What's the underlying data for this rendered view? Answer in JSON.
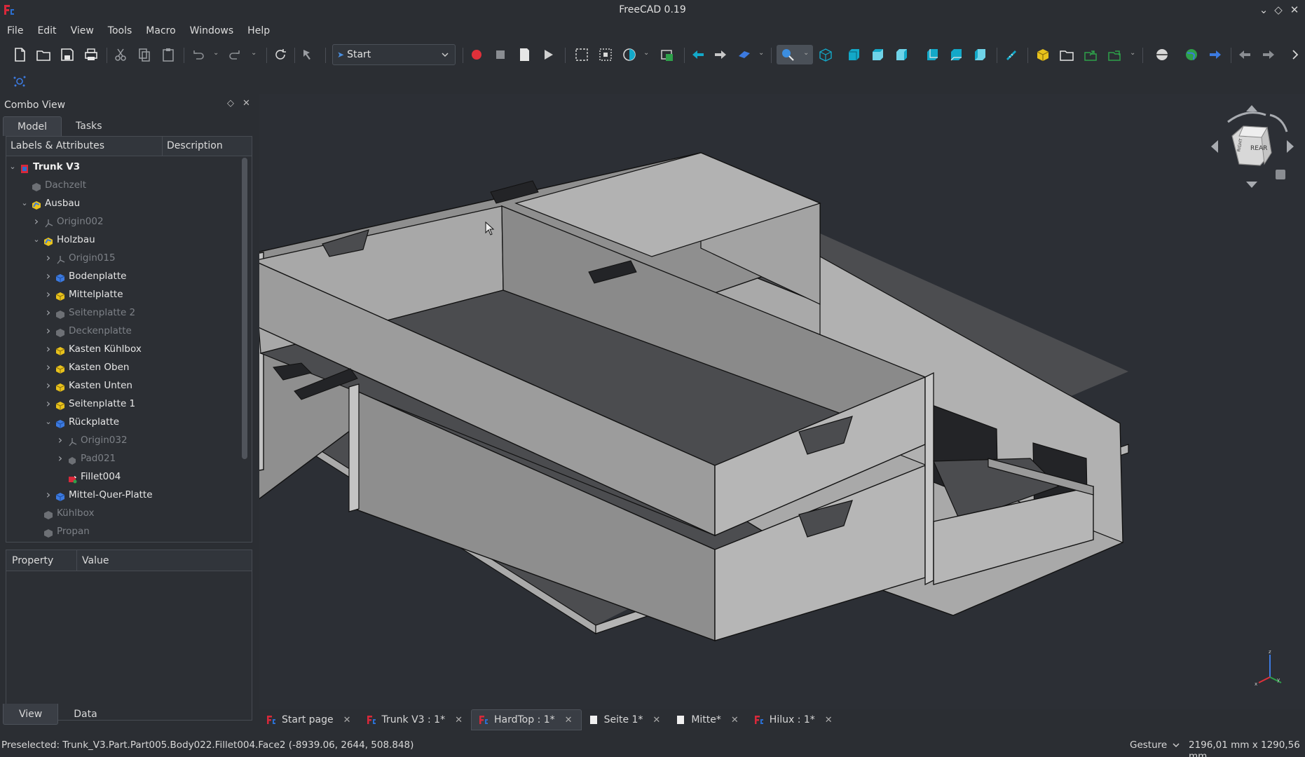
{
  "window": {
    "title": "FreeCAD 0.19"
  },
  "menu": [
    "File",
    "Edit",
    "View",
    "Tools",
    "Macro",
    "Windows",
    "Help"
  ],
  "toolbar": {
    "workbench": "Start"
  },
  "combo_view": {
    "title": "Combo View",
    "tabs": [
      "Model",
      "Tasks"
    ],
    "tree_headers": [
      "Labels & Attributes",
      "Description"
    ],
    "tree": [
      {
        "label": "Trunk V3",
        "level": 0,
        "expanded": true,
        "style": "bold",
        "icon": "document-icon"
      },
      {
        "label": "Dachzelt",
        "level": 1,
        "expanded": null,
        "style": "dim",
        "icon": "part-icon"
      },
      {
        "label": "Ausbau",
        "level": 1,
        "expanded": true,
        "style": "bright",
        "icon": "part-active-icon"
      },
      {
        "label": "Origin002",
        "level": 2,
        "expanded": false,
        "style": "dim",
        "icon": "origin-icon"
      },
      {
        "label": "Holzbau",
        "level": 2,
        "expanded": true,
        "style": "bright",
        "icon": "part-active-icon"
      },
      {
        "label": "Origin015",
        "level": 3,
        "expanded": false,
        "style": "dim",
        "icon": "origin-icon"
      },
      {
        "label": "Bodenplatte",
        "level": 3,
        "expanded": false,
        "style": "bright",
        "icon": "body-blue-icon"
      },
      {
        "label": "Mittelplatte",
        "level": 3,
        "expanded": false,
        "style": "bright",
        "icon": "body-yellow-icon"
      },
      {
        "label": "Seitenplatte 2",
        "level": 3,
        "expanded": false,
        "style": "dim",
        "icon": "body-grey-icon"
      },
      {
        "label": "Deckenplatte",
        "level": 3,
        "expanded": false,
        "style": "dim",
        "icon": "body-grey-icon"
      },
      {
        "label": "Kasten Kühlbox",
        "level": 3,
        "expanded": false,
        "style": "bright",
        "icon": "body-yellow-icon"
      },
      {
        "label": "Kasten Oben",
        "level": 3,
        "expanded": false,
        "style": "bright",
        "icon": "body-yellow-icon"
      },
      {
        "label": "Kasten Unten",
        "level": 3,
        "expanded": false,
        "style": "bright",
        "icon": "body-yellow-icon"
      },
      {
        "label": "Seitenplatte 1",
        "level": 3,
        "expanded": false,
        "style": "bright",
        "icon": "body-yellow-icon"
      },
      {
        "label": "Rückplatte",
        "level": 3,
        "expanded": true,
        "style": "bright",
        "icon": "body-blue-icon"
      },
      {
        "label": "Origin032",
        "level": 4,
        "expanded": false,
        "style": "dim",
        "icon": "origin-icon"
      },
      {
        "label": "Pad021",
        "level": 4,
        "expanded": false,
        "style": "dim",
        "icon": "pad-icon"
      },
      {
        "label": "Fillet004",
        "level": 4,
        "expanded": null,
        "style": "bright",
        "icon": "fillet-icon"
      },
      {
        "label": "Mittel-Quer-Platte",
        "level": 3,
        "expanded": false,
        "style": "bright",
        "icon": "body-blue-icon"
      },
      {
        "label": "Kühlbox",
        "level": 2,
        "expanded": null,
        "style": "dim",
        "icon": "part-icon"
      },
      {
        "label": "Propan",
        "level": 2,
        "expanded": null,
        "style": "dim",
        "icon": "part-icon"
      }
    ],
    "property_headers": [
      "Property",
      "Value"
    ],
    "bottom_tabs": [
      "View",
      "Data"
    ]
  },
  "navigation_cube": {
    "face_label": "REAR",
    "side_label": "RIGHT"
  },
  "document_tabs": [
    {
      "label": "Start page",
      "icon": "freecad-icon",
      "active": false
    },
    {
      "label": "Trunk V3 : 1*",
      "icon": "freecad-icon",
      "active": false
    },
    {
      "label": "HardTop : 1*",
      "icon": "freecad-icon",
      "active": true
    },
    {
      "label": "Seite 1*",
      "icon": "page-icon",
      "active": false
    },
    {
      "label": "Mitte*",
      "icon": "page-icon",
      "active": false
    },
    {
      "label": "Hilux : 1*",
      "icon": "freecad-icon",
      "active": false
    }
  ],
  "status_bar": {
    "message": "Preselected: Trunk_V3.Part.Part005.Body022.Fillet004.Face2 (-8939.06, 2644, 508.848)",
    "navigation_style": "Gesture",
    "dimensions": "2196,01 mm x 1290,56 mm"
  },
  "colors": {
    "background": "#2b2e33",
    "viewport": "#2c2f35",
    "record_red": "#e0303a",
    "accent_teal": "#13a8c8",
    "accent_yellow": "#e8c21c"
  }
}
